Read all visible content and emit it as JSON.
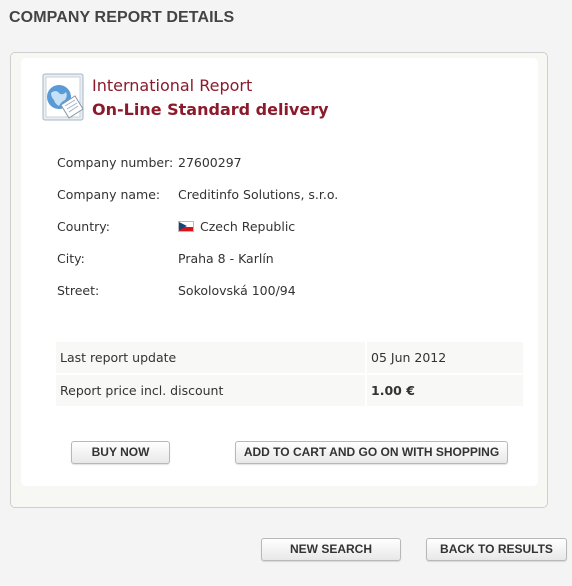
{
  "page": {
    "title": "COMPANY REPORT DETAILS"
  },
  "report": {
    "title": "International Report",
    "subtitle": "On-Line Standard delivery"
  },
  "details": [
    {
      "label": "Company number:",
      "value": "27600297"
    },
    {
      "label": "Company name:",
      "value": "Creditinfo Solutions, s.r.o."
    },
    {
      "label": "Country:",
      "value": "Czech Republic",
      "icon": "czech-flag-icon"
    },
    {
      "label": "City:",
      "value": "Praha 8 - Karlín"
    },
    {
      "label": "Street:",
      "value": "Sokolovská 100/94"
    }
  ],
  "pricing": [
    {
      "label": "Last report update",
      "value": "05 Jun 2012"
    },
    {
      "label": "Report price incl. discount",
      "value": "1.00 €"
    }
  ],
  "buttons": {
    "buy_now": "BUY NOW",
    "add_to_cart": "ADD TO CART AND GO ON WITH SHOPPING",
    "new_search": "NEW SEARCH",
    "back_to_results": "BACK TO RESULTS"
  },
  "colors": {
    "accent": "#8b1a2b",
    "page_background": "#f4f4f4",
    "card_background": "#ffffff"
  }
}
